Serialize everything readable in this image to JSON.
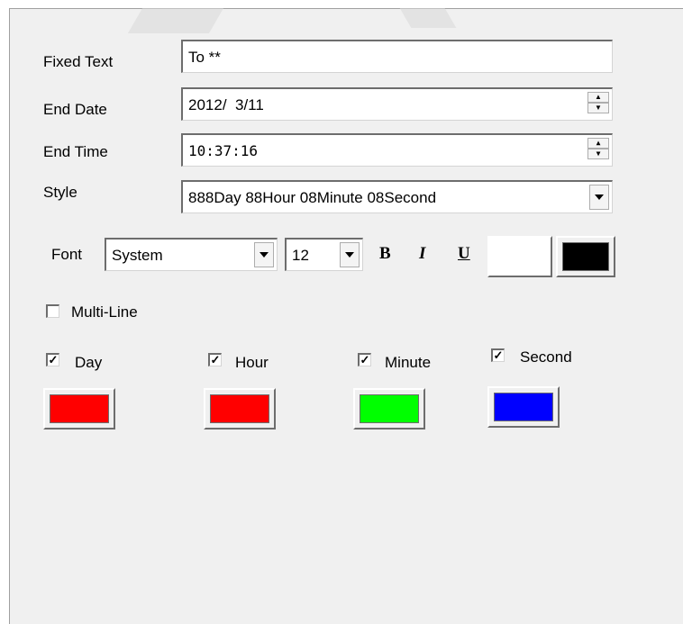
{
  "fields": {
    "fixed_text": {
      "label": "Fixed Text",
      "value": "To **"
    },
    "end_date": {
      "label": "End Date",
      "value": "2012/  3/11"
    },
    "end_time": {
      "label": "End Time",
      "value": "10:37:16"
    },
    "style": {
      "label": "Style",
      "value": "888Day 88Hour 08Minute 08Second"
    }
  },
  "font": {
    "label": "Font",
    "family": "System",
    "size": "12",
    "bold_label": "B",
    "italic_label": "I",
    "underline_label": "U",
    "background_color": "#ffffff",
    "foreground_color": "#000000"
  },
  "multiline": {
    "label": "Multi-Line",
    "checked": false
  },
  "units": [
    {
      "label": "Day",
      "checked": true,
      "color": "#ff0000"
    },
    {
      "label": "Hour",
      "checked": true,
      "color": "#ff0000"
    },
    {
      "label": "Minute",
      "checked": true,
      "color": "#00ff00"
    },
    {
      "label": "Second",
      "checked": true,
      "color": "#0000ff"
    }
  ]
}
